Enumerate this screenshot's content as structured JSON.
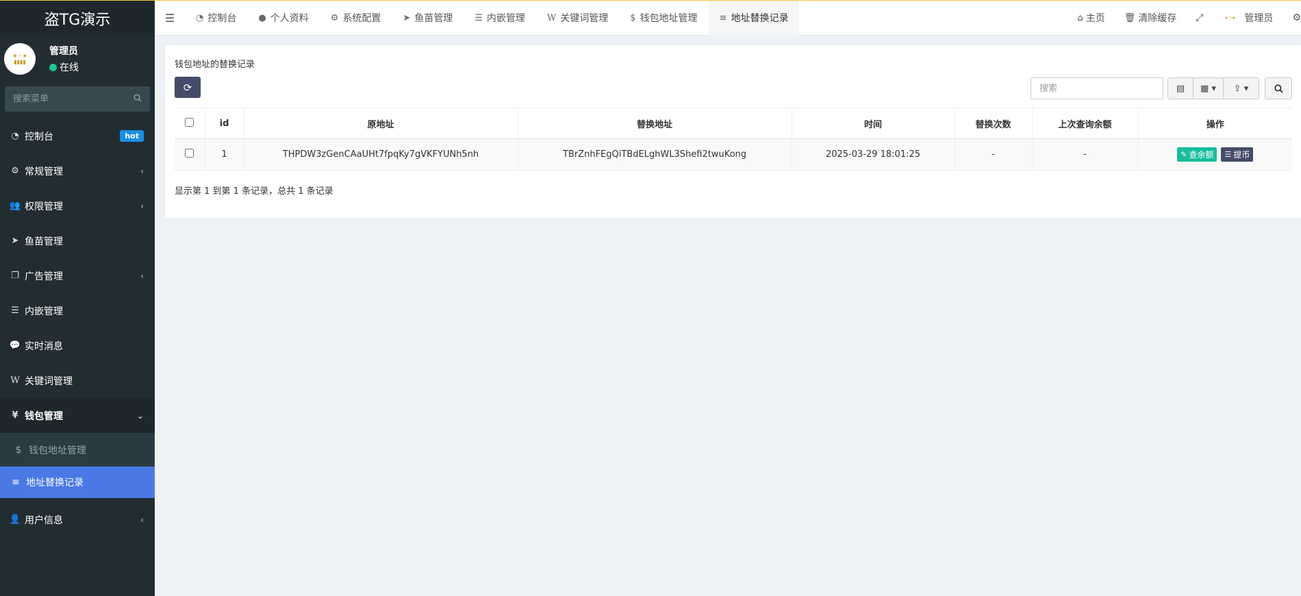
{
  "brand": {
    "title": "盗TG演示"
  },
  "user": {
    "name": "管理员",
    "status": "在线"
  },
  "sidebar": {
    "search_placeholder": "搜索菜单",
    "items": [
      {
        "icon": "dashboard-icon",
        "label": "控制台",
        "badge": "hot"
      },
      {
        "icon": "cogs-icon",
        "label": "常规管理"
      },
      {
        "icon": "users-icon",
        "label": "权限管理"
      },
      {
        "icon": "telegram-icon",
        "label": "鱼苗管理"
      },
      {
        "icon": "clone-icon",
        "label": "广告管理"
      },
      {
        "icon": "bars-icon",
        "label": "内嵌管理"
      },
      {
        "icon": "comments-icon",
        "label": "实时消息"
      },
      {
        "icon": "wikipedia-icon",
        "label": "关键词管理"
      },
      {
        "icon": "yen-icon",
        "label": "钱包管理"
      },
      {
        "icon": "user-icon",
        "label": "用户信息"
      }
    ],
    "submenu": [
      {
        "icon": "dollar-icon",
        "label": "钱包地址管理"
      },
      {
        "icon": "align-left-icon",
        "label": "地址替换记录"
      }
    ]
  },
  "topnav": {
    "tabs": [
      {
        "icon": "dashboard-icon",
        "label": "控制台"
      },
      {
        "icon": "user-icon",
        "label": "个人资料"
      },
      {
        "icon": "cog-icon",
        "label": "系统配置"
      },
      {
        "icon": "telegram-icon",
        "label": "鱼苗管理"
      },
      {
        "icon": "bars-icon",
        "label": "内嵌管理"
      },
      {
        "icon": "wikipedia-icon",
        "label": "关键词管理"
      },
      {
        "icon": "dollar-icon",
        "label": "钱包地址管理"
      },
      {
        "icon": "align-left-icon",
        "label": "地址替换记录"
      }
    ],
    "home": "主页",
    "clear_cache": "清除缓存",
    "admin": "管理员"
  },
  "panel": {
    "title": "钱包地址的替换记录",
    "search_placeholder": "搜索",
    "columns": [
      "id",
      "原地址",
      "替换地址",
      "时间",
      "替换次数",
      "上次查询余额",
      "操作"
    ],
    "rows": [
      {
        "id": "1",
        "original": "THPDW3zGenCAaUHt7fpqKy7gVKFYUNh5nh",
        "replacement": "TBrZnhFEgQiTBdELghWL3Shefi2twuKong",
        "time": "2025-03-29 18:01:25",
        "count": "-",
        "balance": "-",
        "op_balance": "查余额",
        "op_withdraw": "提币"
      }
    ],
    "pager": "显示第 1 到第 1 条记录，总共 1 条记录"
  },
  "colors": {
    "sidebar_bg": "#222d32",
    "active_item": "#4a79e6",
    "hot_badge": "#1a8fe3",
    "online_dot": "#1fc293",
    "btn_green": "#18bc9c",
    "btn_dark": "#444c69",
    "top_border": "#f5c342"
  }
}
